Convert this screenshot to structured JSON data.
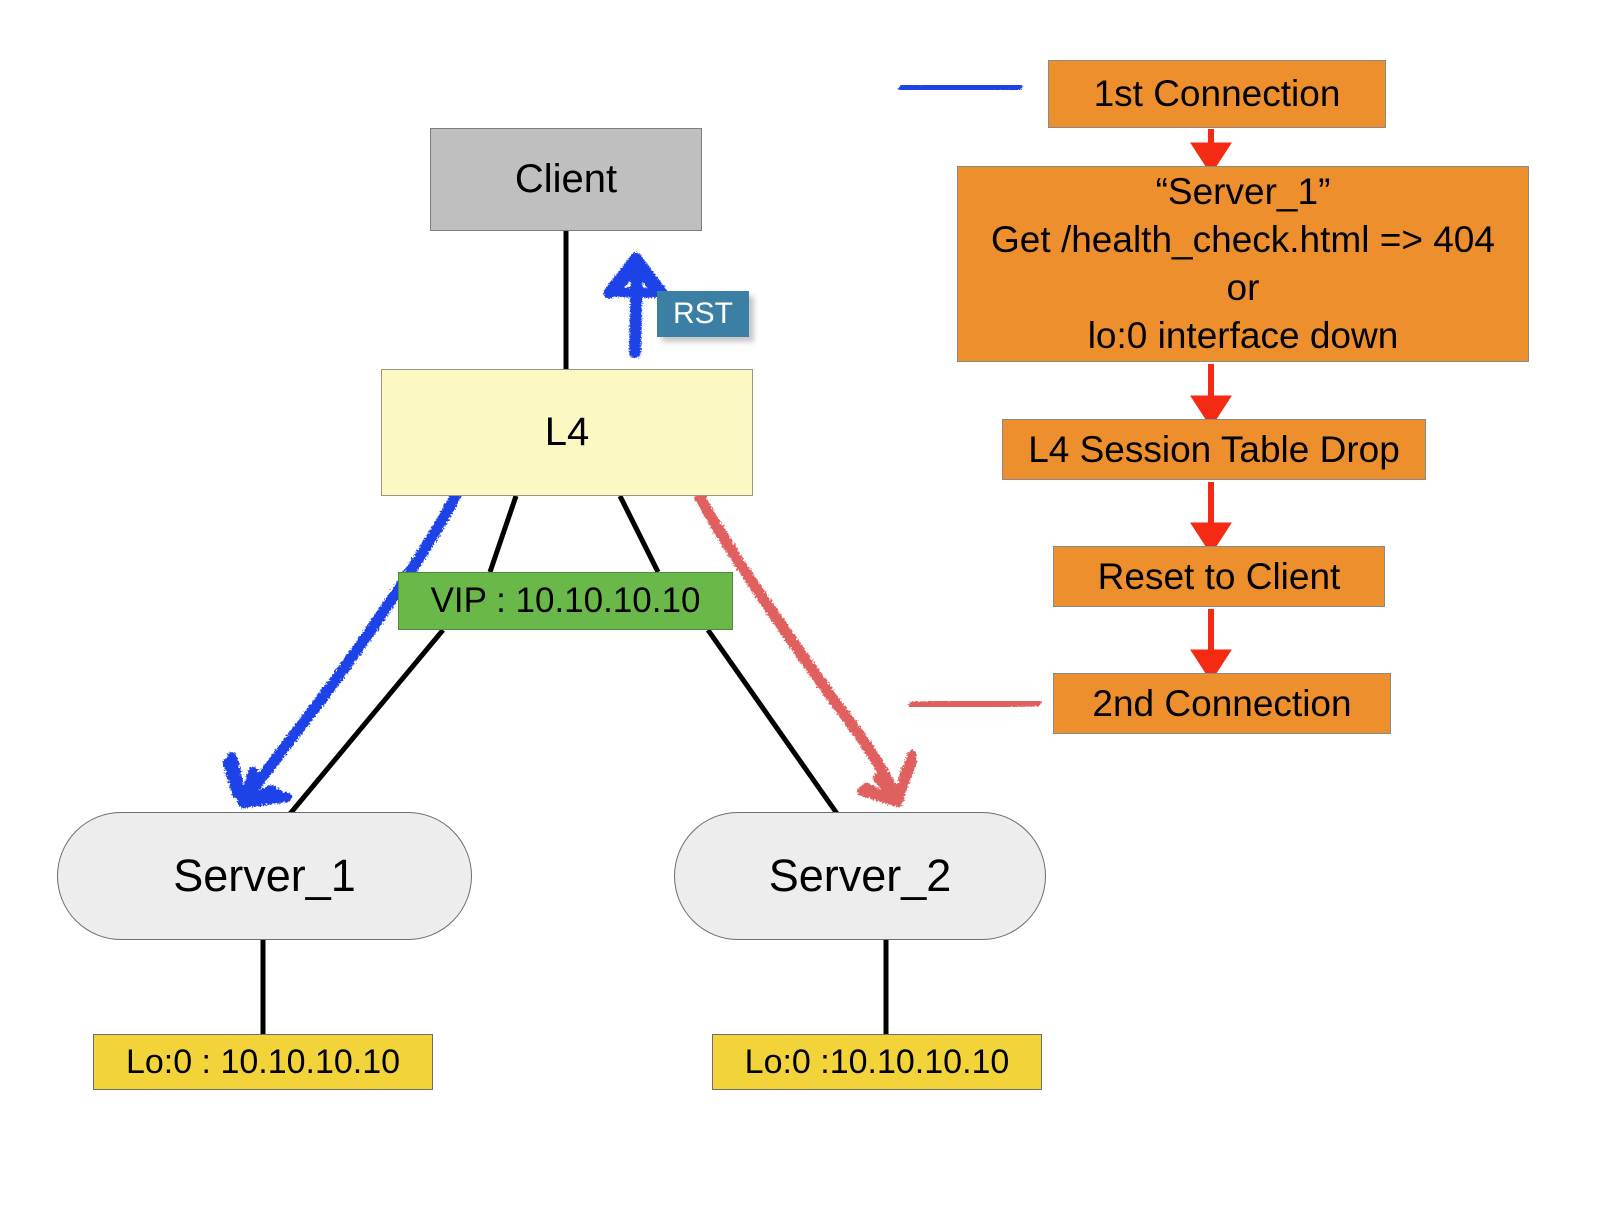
{
  "diagram": {
    "title_absent": true,
    "topology": {
      "client": {
        "label": "Client",
        "color": "#bfbfbf"
      },
      "l4": {
        "label": "L4",
        "color": "#fbf8c4"
      },
      "vip": {
        "label": "VIP : 10.10.10.10",
        "color": "#6ab84a"
      },
      "server_1": {
        "label": "Server_1",
        "color": "#ededed"
      },
      "server_2": {
        "label": "Server_2",
        "color": "#ededed"
      },
      "lo0_server_1": {
        "label": "Lo:0 : 10.10.10.10",
        "color": "#f2d33a"
      },
      "lo0_server_2": {
        "label": "Lo:0 :10.10.10.10",
        "color": "#f2d33a"
      },
      "rst_tag": {
        "label": "RST",
        "color": "#3b7fa5",
        "text_color": "#ffffff"
      }
    },
    "flow": {
      "arrow_color": "#f42a12",
      "box_color": "#ee8f2e",
      "steps": [
        {
          "label": "1st Connection"
        },
        {
          "label": "“Server_1”\nGet /health_check.html => 404\nor\nlo:0 interface down"
        },
        {
          "label": "L4 Session Table Drop"
        },
        {
          "label": "Reset to Client"
        },
        {
          "label": "2nd Connection"
        }
      ]
    },
    "legend": {
      "first_connection_stroke": "#1f42e8",
      "second_connection_stroke": "#e06060"
    },
    "traffic_arrows": [
      {
        "name": "1st-connection-to-server-1",
        "color": "#1f42e8",
        "from": "L4",
        "to": "Server_1"
      },
      {
        "name": "reset-to-client",
        "color": "#1f42e8",
        "from": "L4",
        "to": "Client"
      },
      {
        "name": "2nd-connection-to-server-2",
        "color": "#e06060",
        "from": "L4",
        "to": "Server_2"
      }
    ]
  }
}
